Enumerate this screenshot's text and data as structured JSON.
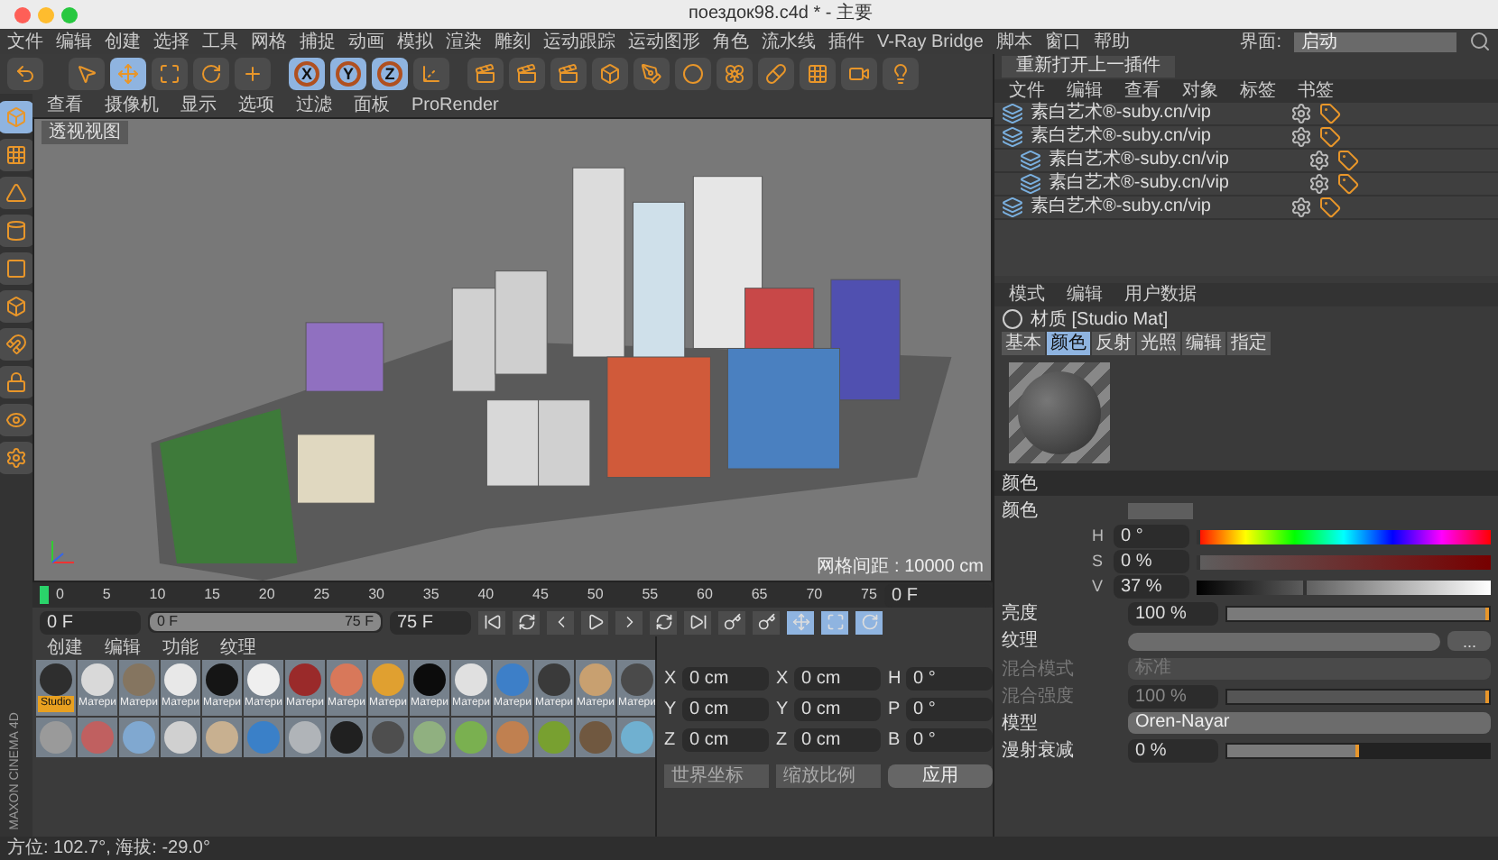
{
  "window": {
    "title": "поездок98.c4d * - 主要"
  },
  "menu_bar": [
    "文件",
    "编辑",
    "创建",
    "选择",
    "工具",
    "网格",
    "捕捉",
    "动画",
    "模拟",
    "渲染",
    "雕刻",
    "运动跟踪",
    "运动图形",
    "角色",
    "流水线",
    "插件",
    "V-Ray Bridge",
    "脚本",
    "窗口",
    "帮助"
  ],
  "layout_selector": {
    "label": "界面:",
    "value": "启动"
  },
  "toolbar": {
    "axis_buttons": [
      {
        "label": "X",
        "selected": true
      },
      {
        "label": "Y",
        "selected": true
      },
      {
        "label": "Z",
        "selected": true
      }
    ]
  },
  "plugin_button": {
    "label": "重新打开上一插件"
  },
  "logo": "MAXON CINEMA 4D",
  "viewport": {
    "menu": [
      "查看",
      "摄像机",
      "显示",
      "选项",
      "过滤",
      "面板",
      "ProRender"
    ],
    "view_name": "透视视图",
    "grid_spacing": "网格间距 : 10000 cm"
  },
  "timeline": {
    "ticks": [
      "0",
      "5",
      "10",
      "15",
      "20",
      "25",
      "30",
      "35",
      "40",
      "45",
      "50",
      "55",
      "60",
      "65",
      "70",
      "75"
    ],
    "current_frame": "0 F",
    "start": "0 F",
    "range": {
      "start": "0 F",
      "end": "75 F",
      "level": 1
    },
    "end": "75 F"
  },
  "material_manager": {
    "menu": [
      "创建",
      "编辑",
      "功能",
      "纹理"
    ],
    "materials": [
      {
        "label": "Studio",
        "color": "#2e2e2e",
        "selected": true
      },
      {
        "label": "Матери",
        "color": "#d9d9d9",
        "selected": false
      },
      {
        "label": "Матери",
        "color": "#857560",
        "selected": false
      },
      {
        "label": "Матери",
        "color": "#e8e8e8",
        "selected": false
      },
      {
        "label": "Матери",
        "color": "#151515",
        "selected": false
      },
      {
        "label": "Матери",
        "color": "#efefef",
        "selected": false
      },
      {
        "label": "Матери",
        "color": "#9a2a2a",
        "selected": false
      },
      {
        "label": "Матери",
        "color": "#d8785a",
        "selected": false
      },
      {
        "label": "Матери",
        "color": "#e0a030",
        "selected": false
      },
      {
        "label": "Матери",
        "color": "#0c0c0c",
        "selected": false
      },
      {
        "label": "Матери",
        "color": "#e0e0e0",
        "selected": false
      },
      {
        "label": "Матери",
        "color": "#3d7fc8",
        "selected": false
      },
      {
        "label": "Матери",
        "color": "#3a3a3a",
        "selected": false
      },
      {
        "label": "Матери",
        "color": "#c8a070",
        "selected": false
      },
      {
        "label": "Матери",
        "color": "#4a4a4a",
        "selected": false
      }
    ],
    "more_materials": [
      {
        "color": "#9a9a9a"
      },
      {
        "color": "#c06060"
      },
      {
        "color": "#80a8d0"
      },
      {
        "color": "#d0d0d0"
      },
      {
        "color": "#c8b090"
      },
      {
        "color": "#3a80c8"
      },
      {
        "color": "#b0b4b8"
      },
      {
        "color": "#202020"
      },
      {
        "color": "#4e4e4e"
      },
      {
        "color": "#90b080"
      },
      {
        "color": "#7ab050"
      },
      {
        "color": "#c08050"
      },
      {
        "color": "#78a030"
      },
      {
        "color": "#705840"
      },
      {
        "color": "#70b0d0"
      }
    ]
  },
  "coordinates": {
    "position": [
      {
        "axis": "X",
        "value": "0 cm"
      },
      {
        "axis": "Y",
        "value": "0 cm"
      },
      {
        "axis": "Z",
        "value": "0 cm"
      }
    ],
    "size": [
      {
        "axis": "X",
        "value": "0 cm"
      },
      {
        "axis": "Y",
        "value": "0 cm"
      },
      {
        "axis": "Z",
        "value": "0 cm"
      }
    ],
    "rotation": [
      {
        "axis": "H",
        "value": "0 °"
      },
      {
        "axis": "P",
        "value": "0 °"
      },
      {
        "axis": "B",
        "value": "0 °"
      }
    ],
    "dropdowns": [
      "世界坐标",
      "缩放比例"
    ],
    "apply": "应用"
  },
  "object_manager": {
    "menu": [
      "文件",
      "编辑",
      "查看",
      "对象",
      "标签",
      "书签"
    ],
    "objects": [
      {
        "name": "素白艺术®-suby.cn/vip"
      },
      {
        "name": "素白艺术®-suby.cn/vip",
        "children": [
          {
            "name": "素白艺术®-suby.cn/vip"
          },
          {
            "name": "素白艺术®-suby.cn/vip"
          }
        ]
      },
      {
        "name": "素白艺术®-suby.cn/vip"
      }
    ]
  },
  "attributes": {
    "menu": [
      "模式",
      "编辑",
      "用户数据"
    ],
    "title": "材质 [Studio Mat]",
    "tabs": [
      {
        "label": "基本",
        "selected": false
      },
      {
        "label": "颜色",
        "selected": true
      },
      {
        "label": "反射",
        "selected": false
      },
      {
        "label": "光照",
        "selected": false
      },
      {
        "label": "编辑",
        "selected": false
      },
      {
        "label": "指定",
        "selected": false
      }
    ],
    "section": "颜色",
    "color_label": "颜色",
    "hsv": [
      {
        "kind": "hue",
        "label": "H",
        "value": "0 °",
        "level": 0
      },
      {
        "kind": "saturation",
        "label": "S",
        "value": "0 %",
        "level": 0
      },
      {
        "kind": "value",
        "label": "V",
        "value": "37 %",
        "level": 0.37
      }
    ],
    "params": [
      {
        "kind": "slider",
        "label": "亮度",
        "value": "100 %",
        "level": 1,
        "disabled": false
      },
      {
        "kind": "texture",
        "label": "纹理",
        "button": "..."
      },
      {
        "kind": "dropdown",
        "label": "混合模式",
        "value": "标准",
        "disabled": true
      },
      {
        "kind": "slider",
        "label": "混合强度",
        "value": "100 %",
        "level": 1,
        "disabled": true
      },
      {
        "kind": "dropdown",
        "label": "模型",
        "value": "Oren-Nayar",
        "disabled": false
      },
      {
        "kind": "slider",
        "label": "漫射衰减",
        "value": "0 %",
        "level": 0.5,
        "disabled": false
      }
    ]
  },
  "status_bar": "方位: 102.7°, 海拔: -29.0°"
}
